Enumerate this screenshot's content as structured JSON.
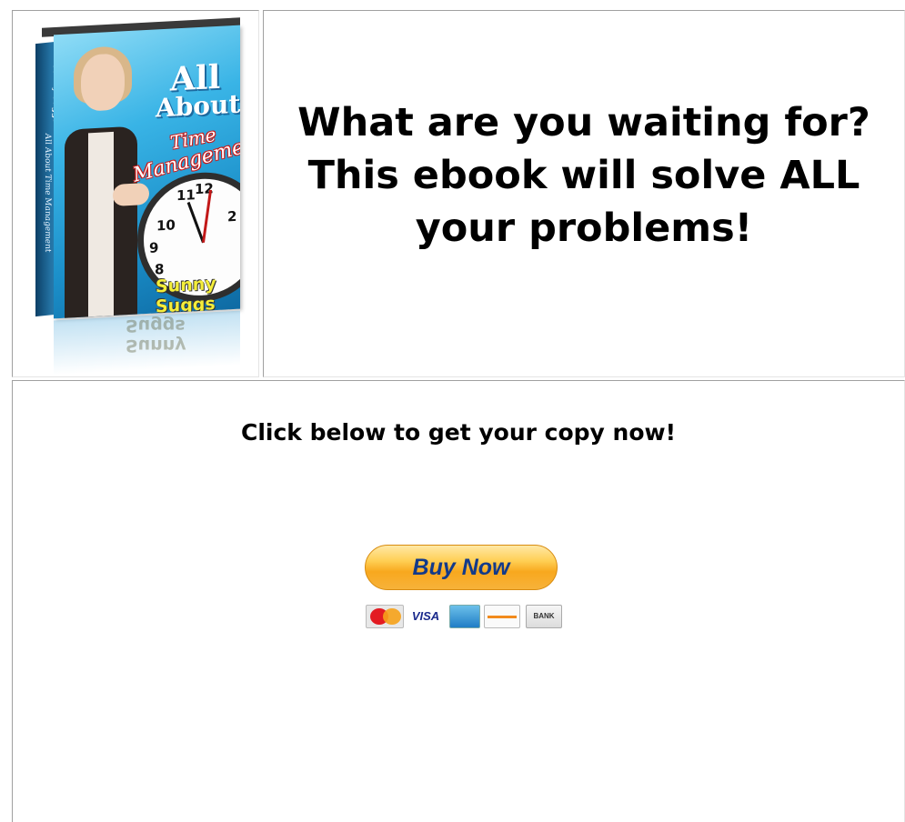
{
  "cover": {
    "title_line1": "All",
    "title_line2": "About",
    "title_line3": "Time",
    "title_line4": "Management",
    "author": "Sunny Suggs",
    "spine_title": "All About Time Management"
  },
  "headline": "What are you waiting for?  This ebook will solve ALL your problems!",
  "cta": "Click below to get your copy now!",
  "buy_button": {
    "label": "Buy Now",
    "color": "#f8a81e",
    "text_color": "#123a8a"
  },
  "payment_methods": [
    {
      "icon": "mastercard-icon"
    },
    {
      "icon": "visa-icon",
      "label": "VISA"
    },
    {
      "icon": "amex-icon"
    },
    {
      "icon": "discover-icon"
    },
    {
      "icon": "bank-icon",
      "label": "BANK"
    }
  ]
}
